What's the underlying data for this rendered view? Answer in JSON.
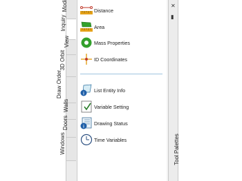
{
  "tabs": [
    {
      "label": "Modify",
      "active": false
    },
    {
      "label": "Inquiry",
      "active": true
    },
    {
      "label": "View",
      "active": false
    },
    {
      "label": "3D Orbit",
      "active": false
    },
    {
      "label": "Draw Order",
      "active": false
    },
    {
      "label": "Walls",
      "active": false
    },
    {
      "label": "Doors",
      "active": false
    },
    {
      "label": "Windows",
      "active": false
    }
  ],
  "tools": [
    {
      "label": "Distance",
      "icon": "distance-icon"
    },
    {
      "label": "Area",
      "icon": "area-icon"
    },
    {
      "label": "Mass Properties",
      "icon": "mass-properties-icon"
    },
    {
      "label": "ID Coordinates",
      "icon": "id-coordinates-icon"
    },
    {
      "label": "List Entity Info",
      "icon": "list-entity-info-icon"
    },
    {
      "label": "Variable Setting",
      "icon": "variable-setting-icon"
    },
    {
      "label": "Drawing Status",
      "icon": "drawing-status-icon"
    },
    {
      "label": "Time Variables",
      "icon": "time-variables-icon"
    }
  ],
  "palette_title": "Tool Palettes",
  "colors": {
    "accent": "#9ec3df",
    "ruler": "#e5a21a",
    "green": "#33a02c",
    "info": "#1f5fa8"
  }
}
